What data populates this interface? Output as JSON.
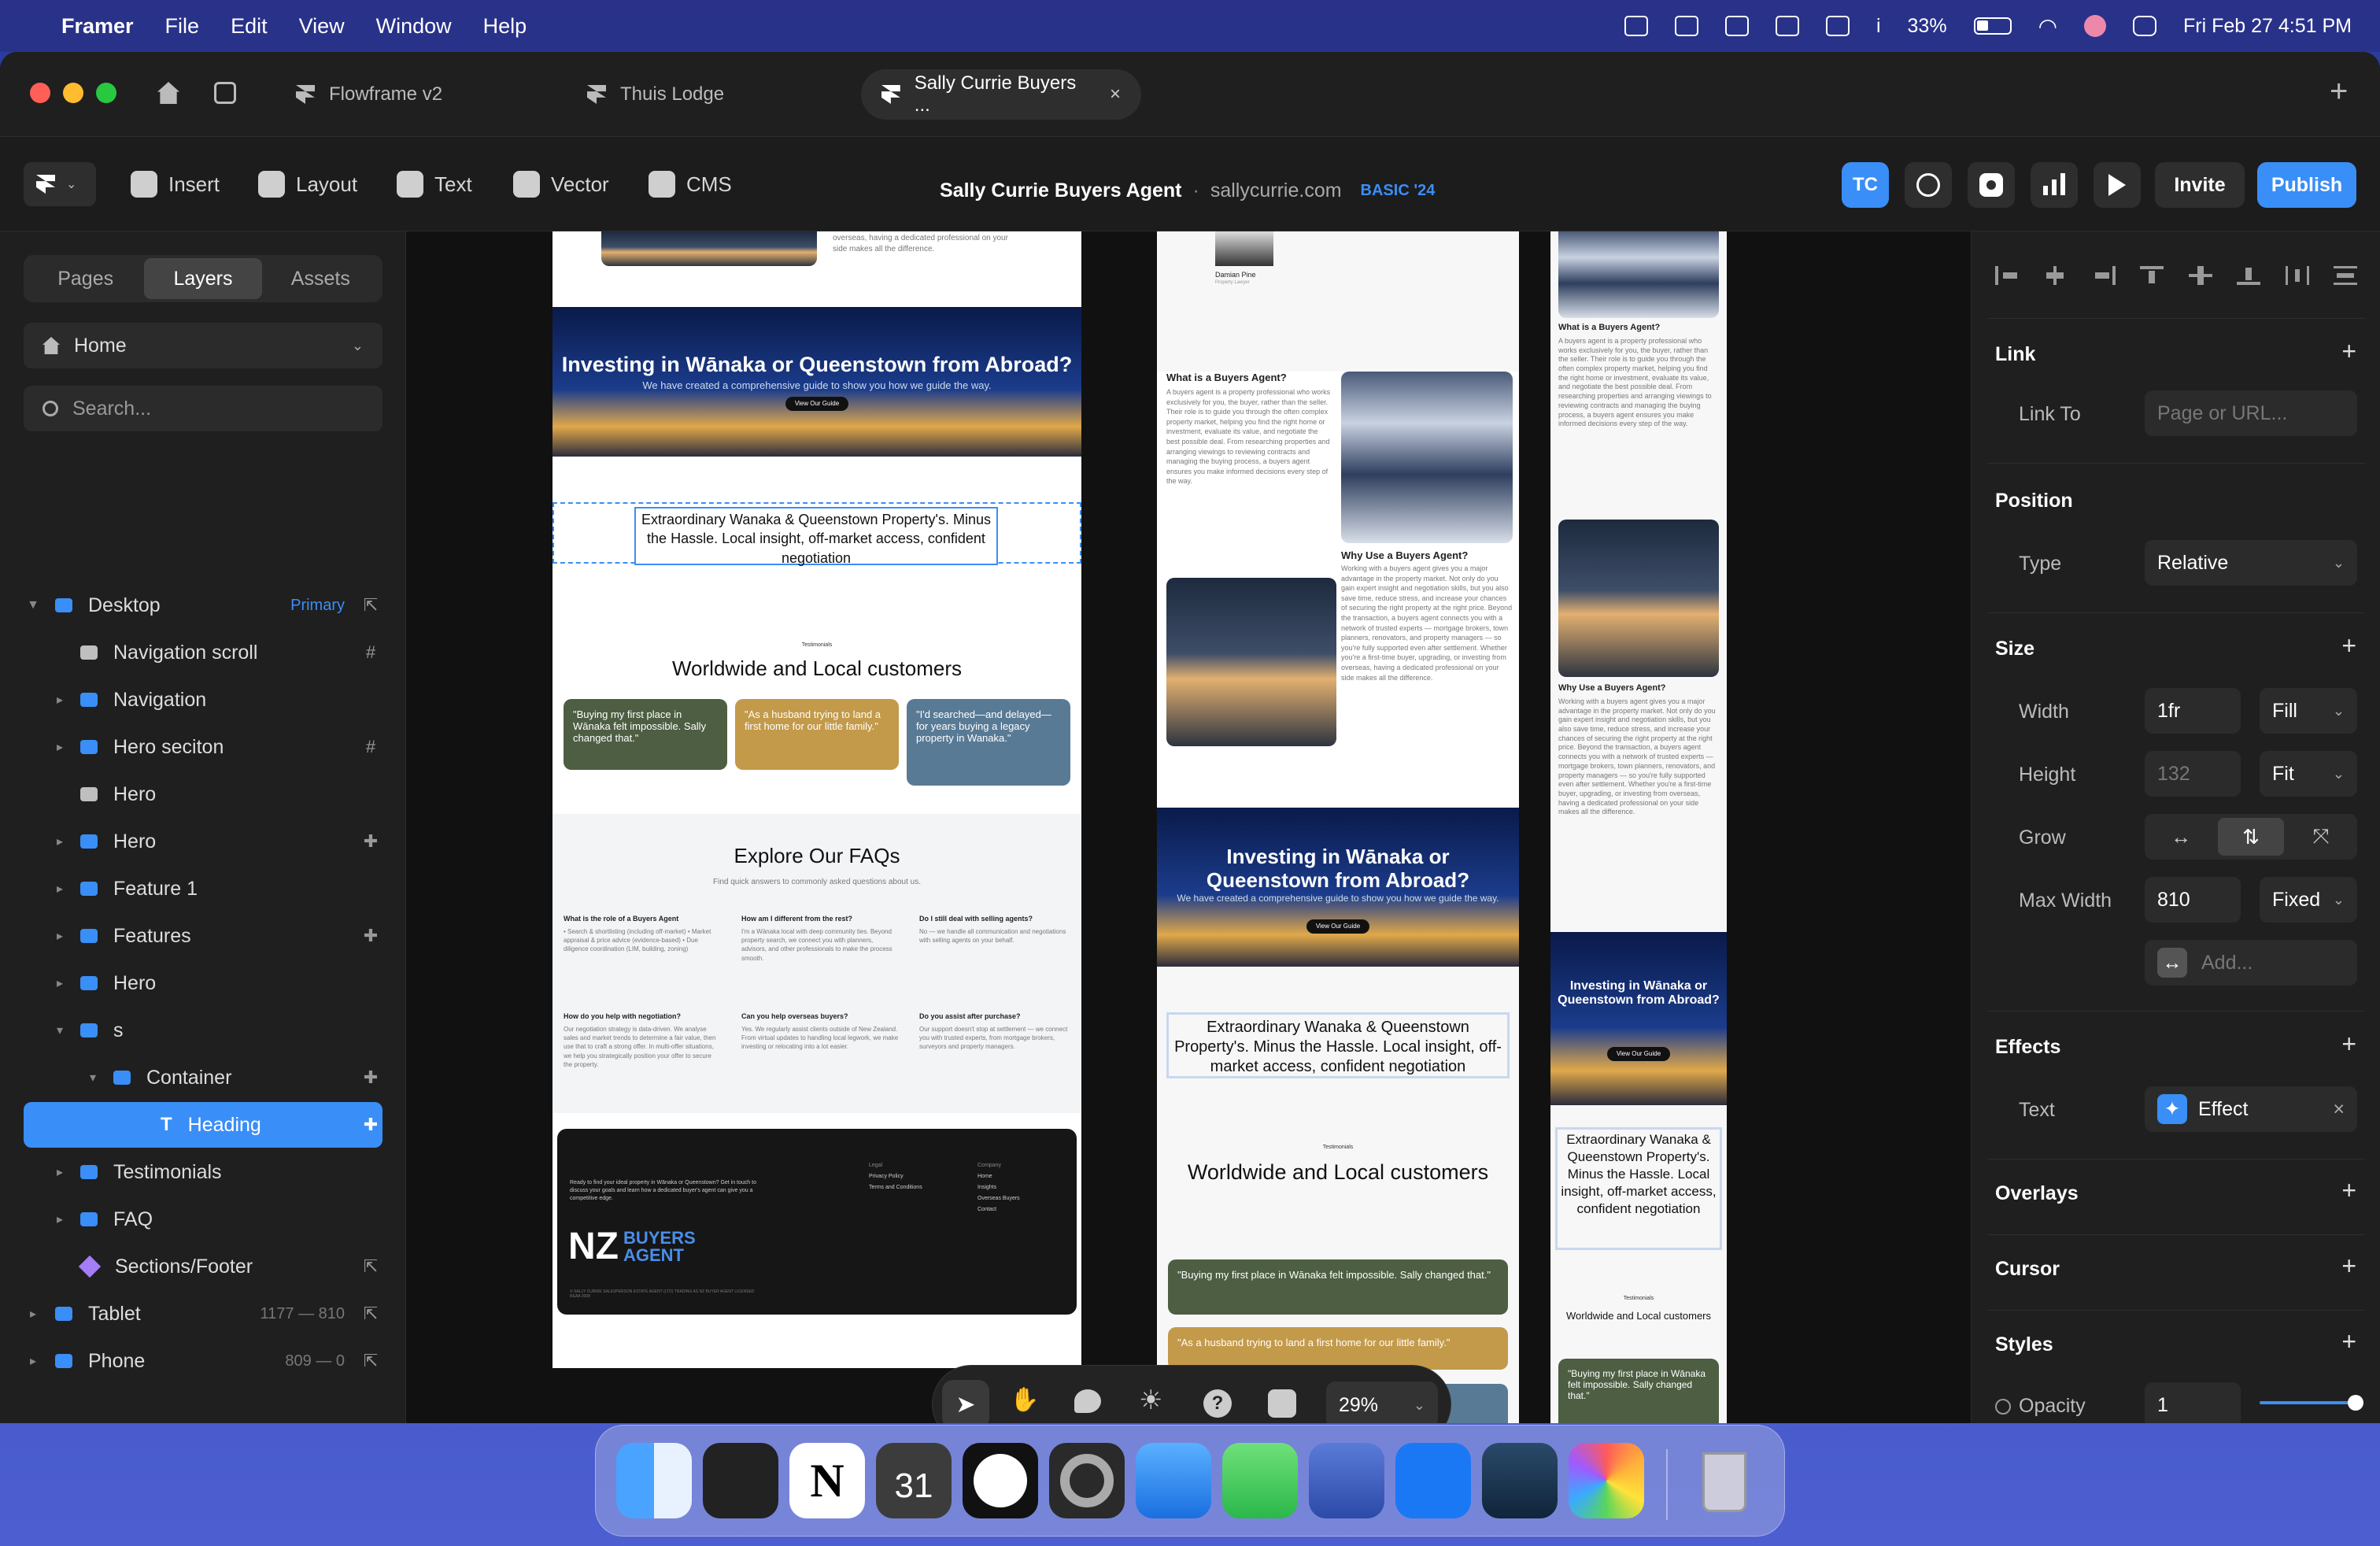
{
  "menubar": {
    "app": "Framer",
    "items": [
      "File",
      "Edit",
      "View",
      "Window",
      "Help"
    ],
    "battery": "33%",
    "datetime": "Fri Feb 27  4:51 PM"
  },
  "tabs": [
    {
      "label": "Flowframe v2"
    },
    {
      "label": "Thuis Lodge"
    },
    {
      "label": "Sally Currie Buyers ..."
    }
  ],
  "toolbar": {
    "insert": "Insert",
    "layout": "Layout",
    "text": "Text",
    "vector": "Vector",
    "cms": "CMS",
    "project_title": "Sally Currie Buyers Agent",
    "domain": "sallycurrie.com",
    "plan": "BASIC '24",
    "avatar": "TC",
    "invite": "Invite",
    "publish": "Publish"
  },
  "left_panel": {
    "tabs": [
      "Pages",
      "Layers",
      "Assets"
    ],
    "page_select": "Home",
    "search_placeholder": "Search...",
    "layers": [
      {
        "name": "Desktop",
        "badge": "Primary"
      },
      {
        "name": "Navigation scroll"
      },
      {
        "name": "Navigation"
      },
      {
        "name": "Hero seciton"
      },
      {
        "name": "Hero"
      },
      {
        "name": "Hero"
      },
      {
        "name": "Feature 1"
      },
      {
        "name": "Features"
      },
      {
        "name": "Hero"
      },
      {
        "name": "s"
      },
      {
        "name": "Container"
      },
      {
        "name": "Heading"
      },
      {
        "name": "Testimonials"
      },
      {
        "name": "FAQ"
      },
      {
        "name": "Sections/Footer"
      },
      {
        "name": "Tablet",
        "dims": "1177 — 810"
      },
      {
        "name": "Phone",
        "dims": "809 — 0"
      }
    ]
  },
  "canvas": {
    "desktop": {
      "hero_heading": "Investing in Wānaka or Queenstown from Abroad?",
      "hero_sub": "We have created a comprehensive guide to show you how we guide the way.",
      "hero_btn": "View Our Guide",
      "top_text": "overseas, having a dedicated professional on your side makes all the difference.",
      "heading": "Extraordinary Wanaka & Queenstown Property's. Minus the Hassle. Local insight, off-market access, confident negotiation",
      "testimonials_kicker": "Testimonials",
      "testimonials_title": "Worldwide and Local customers",
      "quotes": [
        "\"Buying my first place in Wānaka felt impossible. Sally changed that.\"",
        "\"As a husband trying to land a first home for our little family.\"",
        "\"I'd searched—and delayed—for years buying a legacy property in Wanaka.\""
      ],
      "faq_title": "Explore Our FAQs",
      "faq_sub": "Find quick answers to commonly asked questions about us.",
      "faqs": [
        {
          "q": "What is the role of a Buyers Agent",
          "a": "• Search & shortlisting (including off-market) • Market appraisal & price advice (evidence-based) • Due diligence coordination (LIM, building, zoning)"
        },
        {
          "q": "How am I different from the rest?",
          "a": "I'm a Wānaka local with deep community ties. Beyond property search, we connect you with planners, advisors, and other professionals to make the process smooth."
        },
        {
          "q": "Do I still deal with selling agents?",
          "a": "No — we handle all communication and negotiations with selling agents on your behalf."
        },
        {
          "q": "How do you help with negotiation?",
          "a": "Our negotiation strategy is data-driven. We analyse sales and market trends to determine a fair value, then use that to craft a strong offer. In multi-offer situations, we help you strategically position your offer to secure the property."
        },
        {
          "q": "Can you help overseas buyers?",
          "a": "Yes. We regularly assist clients outside of New Zealand. From virtual updates to handling local legwork, we make investing or relocating into a lot easier."
        },
        {
          "q": "Do you assist after purchase?",
          "a": "Our support doesn't stop at settlement — we connect you with trusted experts, from mortgage brokers, surveyors and property managers."
        }
      ],
      "footer_blurb": "Ready to find your ideal property in Wānaka or Queenstown? Get in touch to discuss your goals and learn how a dedicated buyer's agent can give you a competitive edge.",
      "footer_cols": [
        {
          "title": "Legal",
          "links": [
            "Privacy Policy",
            "Terms and Conditions"
          ]
        },
        {
          "title": "Company",
          "links": [
            "Home",
            "Insights",
            "Overseas Buyers",
            "Contact"
          ]
        }
      ],
      "footer_logo_nz": "NZ",
      "footer_logo_buyers": "BUYERS",
      "footer_logo_agent": "AGENT",
      "footer_copy": "© SALLY CURRIE SALESPERSON ESTATE AGENT (LTD) TRADING AS NZ BUYER AGENT LICENSED REAA 2008"
    },
    "tablet": {
      "person": "Damian Pine",
      "person_role": "Property Lawyer",
      "what_title": "What is a Buyers Agent?",
      "what_body": "A buyers agent is a property professional who works exclusively for you, the buyer, rather than the seller. Their role is to guide you through the often complex property market, helping you find the right home or investment, evaluate its value, and negotiate the best possible deal. From researching properties and arranging viewings to reviewing contracts and managing the buying process, a buyers agent ensures you make informed decisions every step of the way.",
      "why_title": "Why Use a Buyers Agent?",
      "why_body": "Working with a buyers agent gives you a major advantage in the property market. Not only do you gain expert insight and negotiation skills, but you also save time, reduce stress, and increase your chances of securing the right property at the right price. Beyond the transaction, a buyers agent connects you with a network of trusted experts — mortgage brokers, town planners, renovators, and property managers — so you're fully supported even after settlement. Whether you're a first-time buyer, upgrading, or investing from overseas, having a dedicated professional on your side makes all the difference.",
      "hero_heading": "Investing in Wānaka or Queenstown from Abroad?",
      "hero_sub": "We have created a comprehensive guide to show you how we guide the way.",
      "hero_btn": "View Our Guide",
      "heading": "Extraordinary Wanaka & Queenstown Property's. Minus the Hassle. Local insight, off-market access, confident negotiation",
      "testimonials_kicker": "Testimonials",
      "testimonials_title": "Worldwide and Local customers",
      "quotes": [
        "\"Buying my first place in Wānaka felt impossible. Sally changed that.\"",
        "\"As a husband trying to land a first home for our little family.\""
      ]
    },
    "phone": {
      "what_title": "What is a Buyers Agent?",
      "what_body": "A buyers agent is a property professional who works exclusively for you, the buyer, rather than the seller. Their role is to guide you through the often complex property market, helping you find the right home or investment, evaluate its value, and negotiate the best possible deal. From researching properties and arranging viewings to reviewing contracts and managing the buying process, a buyers agent ensures you make informed decisions every step of the way.",
      "why_title": "Why Use a Buyers Agent?",
      "why_body": "Working with a buyers agent gives you a major advantage in the property market. Not only do you gain expert insight and negotiation skills, but you also save time, reduce stress, and increase your chances of securing the right property at the right price. Beyond the transaction, a buyers agent connects you with a network of trusted experts — mortgage brokers, town planners, renovators, and property managers — so you're fully supported even after settlement. Whether you're a first-time buyer, upgrading, or investing from overseas, having a dedicated professional on your side makes all the difference.",
      "hero_heading": "Investing in Wānaka or Queenstown from Abroad?",
      "hero_btn": "View Our Guide",
      "heading": "Extraordinary Wanaka & Queenstown Property's. Minus the Hassle. Local insight, off-market access, confident negotiation",
      "testimonials_kicker": "Testimonials",
      "testimonials_title": "Worldwide and Local customers",
      "quote": "\"Buying my first place in Wānaka felt impossible. Sally changed that.\""
    },
    "zoom": "29%"
  },
  "right_panel": {
    "link": {
      "title": "Link",
      "link_to_label": "Link To",
      "link_to_placeholder": "Page or URL..."
    },
    "position": {
      "title": "Position",
      "type_label": "Type",
      "type_value": "Relative"
    },
    "size": {
      "title": "Size",
      "width_label": "Width",
      "width_value": "1fr",
      "width_mode": "Fill",
      "height_label": "Height",
      "height_value": "132",
      "height_mode": "Fit",
      "grow_label": "Grow",
      "maxwidth_label": "Max Width",
      "maxwidth_value": "810",
      "maxwidth_mode": "Fixed",
      "add_placeholder": "Add..."
    },
    "effects": {
      "title": "Effects",
      "text_label": "Text",
      "effect_value": "Effect"
    },
    "overlays": "Overlays",
    "cursor": "Cursor",
    "styles": {
      "title": "Styles",
      "opacity_label": "Opacity",
      "opacity_value": "1"
    }
  },
  "colors": {
    "accent": "#3a8ef7",
    "card_green": "#4d5e43",
    "card_gold": "#c39a4a",
    "card_blue": "#587a95"
  }
}
